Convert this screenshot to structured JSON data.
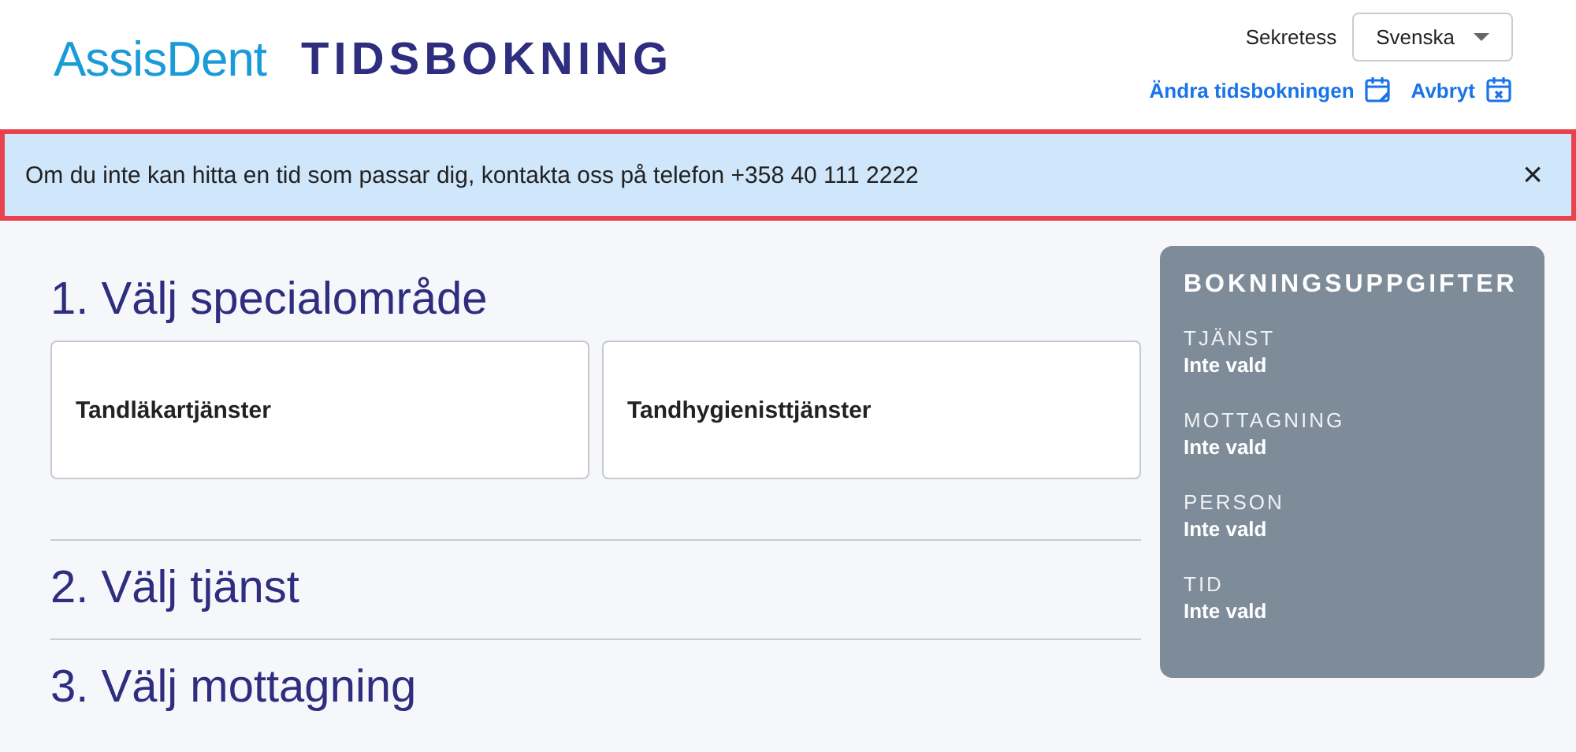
{
  "header": {
    "logo": "AssisDent",
    "title": "TIDSBOKNING",
    "privacy_label": "Sekretess",
    "language": "Svenska",
    "links": [
      {
        "label": "Ändra tidsbokningen",
        "kind": "edit"
      },
      {
        "label": "Avbryt",
        "kind": "cancel"
      }
    ]
  },
  "notice": {
    "text": "Om du inte kan hitta en tid som passar dig, kontakta oss på telefon +358 40 111 2222",
    "close": "×"
  },
  "steps": [
    {
      "title": "1. Välj specialområde",
      "options": [
        "Tandläkartjänster",
        "Tandhygienisttjänster"
      ]
    },
    {
      "title": "2. Välj tjänst"
    },
    {
      "title": "3. Välj mottagning"
    }
  ],
  "summary": {
    "title": "BOKNINGSUPPGIFTER",
    "fields": [
      {
        "label": "TJÄNST",
        "value": "Inte vald"
      },
      {
        "label": "MOTTAGNING",
        "value": "Inte vald"
      },
      {
        "label": "PERSON",
        "value": "Inte vald"
      },
      {
        "label": "TID",
        "value": "Inte vald"
      }
    ]
  }
}
